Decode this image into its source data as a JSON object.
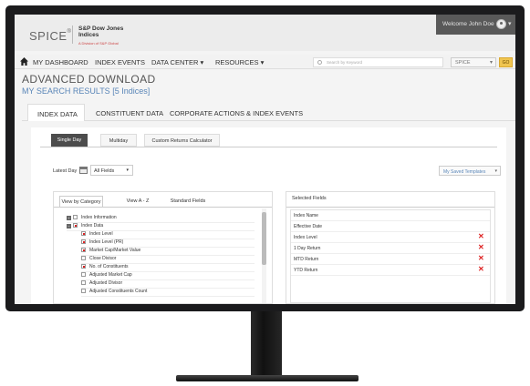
{
  "brand": {
    "app_name": "SPICE",
    "reg_mark": "®",
    "company": "S&P Dow Jones Indices",
    "parent": "A Division of S&P Global"
  },
  "user": {
    "welcome": "Welcome John Doe"
  },
  "nav": {
    "items": [
      "MY DASHBOARD",
      "INDEX EVENTS",
      "DATA CENTER ▾",
      "RESOURCES ▾"
    ],
    "search_placeholder": "Search by Keyword",
    "product_select": "SPICE",
    "go_label": "GO"
  },
  "page": {
    "title": "ADVANCED DOWNLOAD",
    "subtitle": "MY SEARCH RESULTS [5 Indices]"
  },
  "tabs": [
    "INDEX DATA",
    "CONSTITUENT DATA",
    "CORPORATE ACTIONS & INDEX EVENTS"
  ],
  "subtabs": [
    "Single Day",
    "Multiday",
    "Custom Returns Calculator"
  ],
  "controls": {
    "date_label": "Latest Day",
    "fields_select": "All Fields",
    "templates": "My Saved Templates"
  },
  "left_panel": {
    "tabs": [
      "View by Category",
      "View A - Z",
      "Standard Fields"
    ],
    "rows": [
      {
        "label": "Index Information",
        "toggle": "+",
        "checked": false
      },
      {
        "label": "Index Data",
        "toggle": "−",
        "checked": true
      },
      {
        "label": "Index Level",
        "checked": true
      },
      {
        "label": "Index Level (PR)",
        "checked": true
      },
      {
        "label": "Market Cap/Market Value",
        "checked": true
      },
      {
        "label": "Close Divisor",
        "checked": false
      },
      {
        "label": "No. of Constituents",
        "checked": true
      },
      {
        "label": "Adjusted Market Cap",
        "checked": false
      },
      {
        "label": "Adjusted Divisor",
        "checked": false
      },
      {
        "label": "Adjusted Constituents Count",
        "checked": false
      }
    ]
  },
  "right_panel": {
    "title": "Selected Fields",
    "rows": [
      {
        "label": "Index Name",
        "removable": false
      },
      {
        "label": "Effective Date",
        "removable": false
      },
      {
        "label": "Index Level",
        "removable": true
      },
      {
        "label": "1 Day Return",
        "removable": true
      },
      {
        "label": "MTD Return",
        "removable": true
      },
      {
        "label": "YTD Return",
        "removable": true
      }
    ]
  }
}
